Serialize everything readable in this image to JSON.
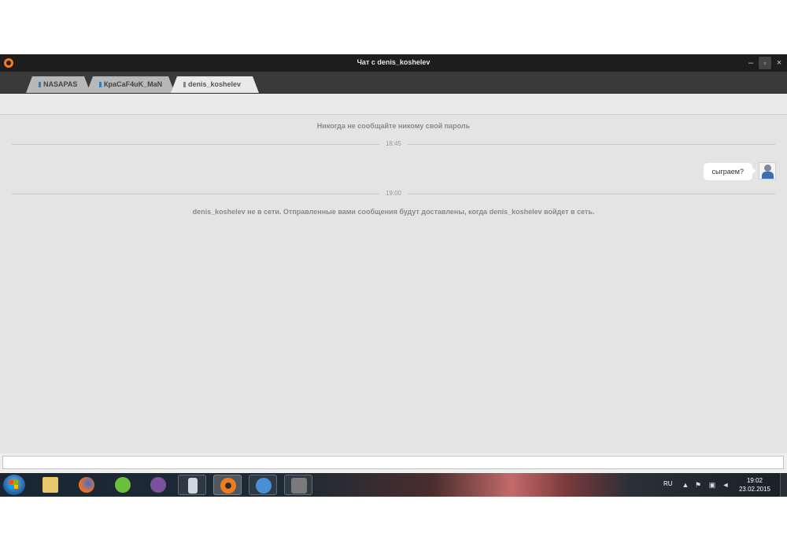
{
  "window": {
    "title": "Чат с denis_koshelev",
    "controls": {
      "minimize": "–",
      "restore": "▫",
      "close": "×"
    }
  },
  "tabs": [
    {
      "label": "NASAPAS",
      "active": false,
      "status_color": "#2f7fbf"
    },
    {
      "label": "КраСаF4uK_MaN",
      "active": false,
      "status_color": "#2f7fbf"
    },
    {
      "label": "denis_koshelev",
      "active": true,
      "status_color": "#888888"
    }
  ],
  "chat": {
    "security_notice": "Никогда не сообщайте никому свой пароль",
    "timestamps": [
      "18:45",
      "19:00"
    ],
    "messages": [
      {
        "text": "сыграем?",
        "outgoing": true,
        "avatar_icon": "user-avatar-icon"
      }
    ],
    "offline_notice": "denis_koshelev не в сети. Отправленные вами сообщения будут доставлены, когда denis_koshelev войдет в сеть."
  },
  "input": {
    "value": "",
    "placeholder": ""
  },
  "taskbar": {
    "apps": [
      {
        "name": "file-explorer-icon",
        "color": "#e8c86a"
      },
      {
        "name": "firefox-icon",
        "color": "#e8702a"
      },
      {
        "name": "utorrent-icon",
        "color": "#6cbf3a"
      },
      {
        "name": "viber-icon",
        "color": "#7b519d"
      },
      {
        "name": "phone-app-icon",
        "color": "#cfd8e0"
      },
      {
        "name": "origin-icon",
        "color": "#f07c1e"
      },
      {
        "name": "security-shield-icon",
        "color": "#4a8fd6"
      },
      {
        "name": "world-of-tanks-icon",
        "color": "#9a9a9a"
      }
    ],
    "language": "RU",
    "time": "19:02",
    "date": "23.02.2015"
  },
  "colors": {
    "titlebar": "#1d1d1d",
    "chat_background": "#e4e4e4",
    "accent_orange": "#f07c1e",
    "tab_status_blue": "#2f7fbf",
    "input_border": "#f0c060"
  }
}
